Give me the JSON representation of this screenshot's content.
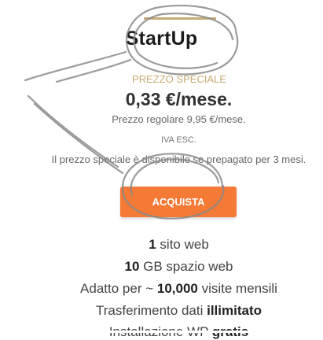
{
  "plan": {
    "title": "StartUp",
    "special_label": "PREZZO SPECIALE",
    "price": "0,33 €/mese.",
    "regular_price": "Prezzo regolare 9,95 €/mese.",
    "vat": "IVA ESC.",
    "note": "Il prezzo speciale è disponibile se prepagato per 3 mesi.",
    "buy_label": "ACQUISTA"
  },
  "features": [
    {
      "bold": "1",
      "text": " sito web"
    },
    {
      "bold": "10",
      "text": " GB spazio web"
    },
    {
      "pre": "Adatto per ~ ",
      "bold": "10,000",
      "text": " visite mensili"
    },
    {
      "pre": "Trasferimento dati ",
      "bold": "illimitato",
      "text": ""
    },
    {
      "pre": "Installazione WP ",
      "bold": "gratis",
      "text": ""
    }
  ],
  "colors": {
    "accent_gold": "#c8aa74",
    "button": "#f47a36"
  }
}
